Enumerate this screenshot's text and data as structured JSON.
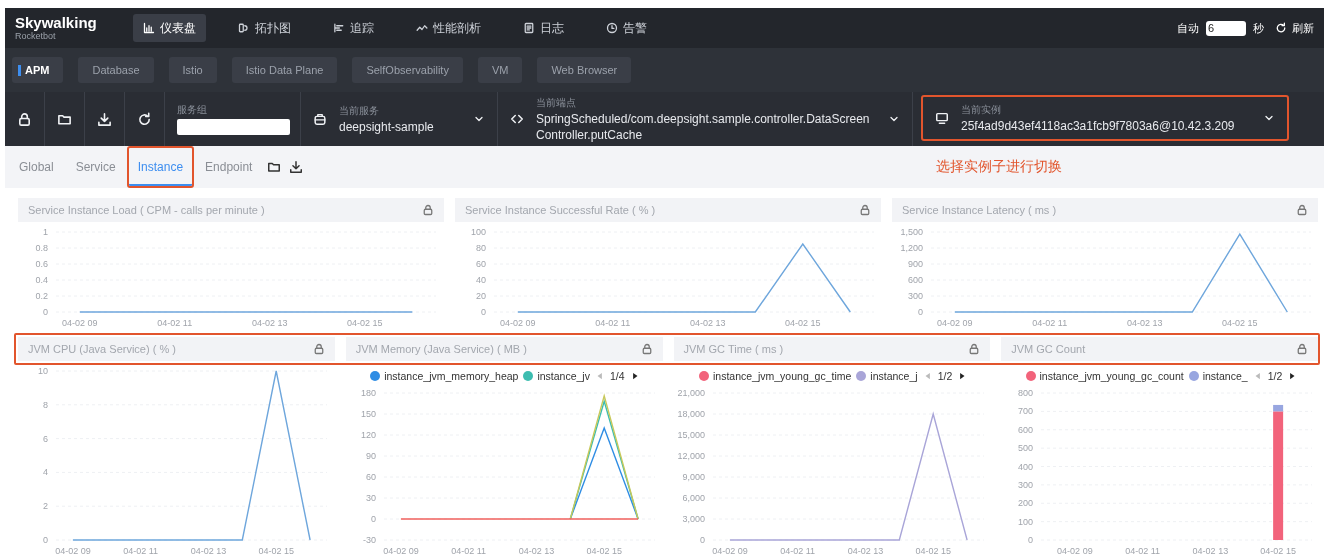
{
  "top_nav": {
    "logo": "Skywalking",
    "logo_sub": "Rocketbot",
    "items": [
      {
        "label": "仪表盘",
        "selected": true
      },
      {
        "label": "拓扑图",
        "selected": false
      },
      {
        "label": "追踪",
        "selected": false
      },
      {
        "label": "性能剖析",
        "selected": false
      },
      {
        "label": "日志",
        "selected": false
      },
      {
        "label": "告警",
        "selected": false
      }
    ],
    "auto_label": "自动",
    "interval": "6",
    "unit": "秒",
    "refresh": "刷新"
  },
  "layers": [
    {
      "label": "APM",
      "selected": true
    },
    {
      "label": "Database",
      "selected": false
    },
    {
      "label": "Istio",
      "selected": false
    },
    {
      "label": "Istio Data Plane",
      "selected": false
    },
    {
      "label": "SelfObservability",
      "selected": false
    },
    {
      "label": "VM",
      "selected": false
    },
    {
      "label": "Web Browser",
      "selected": false
    }
  ],
  "toolbar": {
    "group": {
      "label": "服务组"
    },
    "service": {
      "label": "当前服务",
      "value": "deepsight-sample",
      "highlighted": false
    },
    "endpoint": {
      "label": "当前端点",
      "value": "SpringScheduled/com.deepsight.sample.controller.DataScreenController.putCache",
      "highlighted": false
    },
    "instance": {
      "label": "当前实例",
      "value": "25f4ad9d43ef4118ac3a1fcb9f7803a6@10.42.3.209",
      "highlighted": true
    }
  },
  "dashboard_tabs": [
    {
      "label": "Global",
      "selected": false,
      "highlighted": false
    },
    {
      "label": "Service",
      "selected": false,
      "highlighted": false
    },
    {
      "label": "Instance",
      "selected": true,
      "highlighted": true
    },
    {
      "label": "Endpoint",
      "selected": false,
      "highlighted": false
    }
  ],
  "note": "选择实例子进行切换",
  "chart_rows": [
    {
      "highlighted": false,
      "panels": [
        {
          "title": "Service Instance Load ( CPM - calls per minute )",
          "chart_data": {
            "type": "line",
            "grid": true,
            "categories": [
              "04-02 09",
              null,
              "04-02 11",
              null,
              "04-02 13",
              null,
              "04-02 15",
              null
            ],
            "ylim": [
              0,
              1
            ],
            "yticks": [
              0,
              0.2,
              0.4,
              0.6,
              0.8,
              1
            ],
            "series": [
              {
                "color": "#6ea6dc",
                "values": [
                  0,
                  0,
                  0,
                  0,
                  0,
                  0,
                  0,
                  0
                ]
              }
            ]
          }
        },
        {
          "title": "Service Instance Successful Rate ( % )",
          "chart_data": {
            "type": "line",
            "grid": true,
            "categories": [
              "04-02 09",
              null,
              "04-02 11",
              null,
              "04-02 13",
              null,
              "04-02 15",
              null
            ],
            "ylim": [
              0,
              100
            ],
            "yticks": [
              0,
              20,
              40,
              60,
              80,
              100
            ],
            "series": [
              {
                "color": "#6ea6dc",
                "values": [
                  0,
                  0,
                  0,
                  0,
                  0,
                  0,
                  85,
                  0
                ]
              }
            ]
          }
        },
        {
          "title": "Service Instance Latency ( ms )",
          "chart_data": {
            "type": "line",
            "grid": true,
            "categories": [
              "04-02 09",
              null,
              "04-02 11",
              null,
              "04-02 13",
              null,
              "04-02 15",
              null
            ],
            "ylim": [
              0,
              1500
            ],
            "yticks": [
              0,
              300,
              600,
              900,
              {
                "value": 1200,
                "label": "1,200"
              },
              {
                "value": 1500,
                "label": "1,500"
              }
            ],
            "series": [
              {
                "color": "#6ea6dc",
                "values": [
                  0,
                  0,
                  0,
                  0,
                  0,
                  0,
                  1460,
                  0
                ]
              }
            ]
          }
        }
      ]
    },
    {
      "highlighted": true,
      "panels": [
        {
          "title": "JVM CPU (Java Service) ( % )",
          "chart_data": {
            "type": "line",
            "grid": true,
            "categories": [
              "04-02 09",
              null,
              "04-02 11",
              null,
              "04-02 13",
              null,
              "04-02 15",
              null
            ],
            "ylim": [
              0,
              10
            ],
            "yticks": [
              0,
              2,
              4,
              6,
              8,
              10
            ],
            "series": [
              {
                "color": "#6ea6dc",
                "values": [
                  0,
                  0,
                  0,
                  0,
                  0,
                  0,
                  10,
                  0
                ]
              }
            ]
          }
        },
        {
          "title": "JVM Memory (Java Service) ( MB )",
          "legend_pager": "1/4",
          "chart_data": {
            "type": "line",
            "grid": true,
            "legend": "top",
            "categories": [
              "04-02 09",
              null,
              "04-02 11",
              null,
              "04-02 13",
              null,
              "04-02 15",
              null
            ],
            "ylim": [
              -30,
              180
            ],
            "yticks": [
              -30,
              0,
              30,
              60,
              90,
              120,
              150,
              180
            ],
            "series": [
              {
                "name": "instance_jvm_memory_heap",
                "color": "#2f8de4",
                "values": [
                  null,
                  null,
                  null,
                  null,
                  null,
                  0,
                  130,
                  0
                ]
              },
              {
                "name": "instance_jv",
                "color": "#3dbdb0",
                "values": [
                  null,
                  null,
                  null,
                  null,
                  null,
                  0,
                  168,
                  0
                ]
              },
              {
                "color": "#c8c85a",
                "values": [
                  null,
                  null,
                  null,
                  null,
                  null,
                  0,
                  176,
                  0
                ]
              },
              {
                "color": "#f0605d",
                "values": [
                  0,
                  0,
                  0,
                  0,
                  0,
                  0,
                  0,
                  0
                ]
              }
            ]
          }
        },
        {
          "title": "JVM GC Time ( ms )",
          "legend_pager": "1/2",
          "chart_data": {
            "type": "line",
            "grid": true,
            "legend": "top",
            "categories": [
              "04-02 09",
              null,
              "04-02 11",
              null,
              "04-02 13",
              null,
              "04-02 15",
              null
            ],
            "ylim": [
              0,
              21000
            ],
            "yticks": [
              0,
              {
                "value": 3000,
                "label": "3,000"
              },
              {
                "value": 6000,
                "label": "6,000"
              },
              {
                "value": 9000,
                "label": "9,000"
              },
              {
                "value": 12000,
                "label": "12,000"
              },
              {
                "value": 15000,
                "label": "15,000"
              },
              {
                "value": 18000,
                "label": "18,000"
              },
              {
                "value": 21000,
                "label": "21,000"
              }
            ],
            "series": [
              {
                "name": "instance_jvm_young_gc_time",
                "color": "#f2637b",
                "values": [
                  null,
                  null,
                  null,
                  null,
                  null,
                  null,
                  null,
                  null
                ]
              },
              {
                "name": "instance_j",
                "color": "#a9a5d8",
                "values": [
                  0,
                  0,
                  0,
                  0,
                  0,
                  0,
                  18000,
                  0
                ]
              }
            ]
          }
        },
        {
          "title": "JVM GC Count",
          "legend_pager": "1/2",
          "chart_data": {
            "type": "bar",
            "stacked": true,
            "grid": true,
            "legend": "top",
            "categories": [
              "04-02 09",
              "04-02 11",
              "04-02 13",
              "04-02 15"
            ],
            "ylim": [
              0,
              800
            ],
            "yticks": [
              0,
              100,
              200,
              300,
              400,
              500,
              600,
              700,
              800
            ],
            "series": [
              {
                "name": "instance_jvm_young_gc_count",
                "color": "#f2637b",
                "values": [
                  null,
                  null,
                  null,
                  700
                ]
              },
              {
                "name": "instance_",
                "color": "#98a6e0",
                "values": [
                  null,
                  null,
                  null,
                  35
                ]
              }
            ]
          }
        }
      ]
    }
  ]
}
